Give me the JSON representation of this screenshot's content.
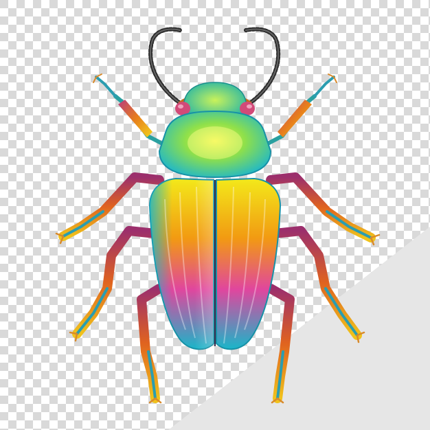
{
  "image": {
    "subject": "beetle-icon",
    "background": "transparency-checkerboard",
    "colors": {
      "checker_light": "#ffffff",
      "checker_dark": "#d9d9d9",
      "corner_fold": "#e6e6e6",
      "pronotum_center": "#e8f238",
      "pronotum_edge": "#1fb7c9",
      "elytra_teal": "#19b6c9",
      "elytra_yellow": "#f3e91a",
      "elytra_orange": "#f29a12",
      "elytra_magenta": "#e0469e",
      "leg_magenta": "#b83b7f",
      "leg_orange": "#e77d1c",
      "antenna_dark": "#2b2b2b"
    }
  }
}
